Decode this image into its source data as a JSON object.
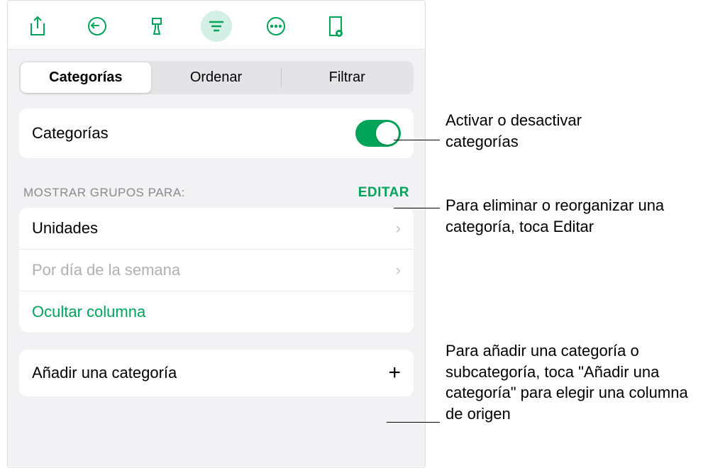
{
  "toolbar": {
    "icons": [
      "share",
      "undo",
      "brush",
      "organize",
      "more",
      "note-preview"
    ]
  },
  "segmented": {
    "items": [
      "Categorías",
      "Ordenar",
      "Filtrar"
    ],
    "selected": 0
  },
  "categories_card": {
    "label": "Categorías",
    "toggle_on": true
  },
  "groups_section": {
    "header": "MOSTRAR GRUPOS PARA:",
    "edit": "EDITAR",
    "rows": [
      {
        "label": "Unidades",
        "type": "nav"
      },
      {
        "label": "Por día de la semana",
        "type": "placeholder-nav"
      },
      {
        "label": "Ocultar columna",
        "type": "link"
      }
    ]
  },
  "add_category": {
    "label": "Añadir una categoría"
  },
  "callouts": {
    "toggle": "Activar o desactivar categorías",
    "edit": "Para eliminar o reorganizar una categoría, toca Editar",
    "add": "Para añadir una categoría o subcategoría, toca \"Añadir una categoría\" para elegir una columna de origen"
  }
}
